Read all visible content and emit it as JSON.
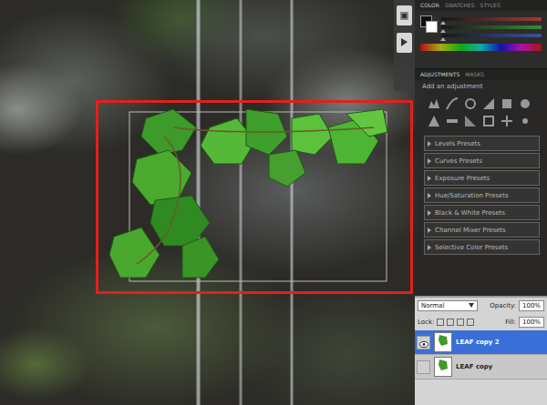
{
  "panels": {
    "color": {
      "tabs": [
        {
          "label": "COLOR",
          "selected": true
        },
        {
          "label": "SWATCHES",
          "selected": false
        },
        {
          "label": "STYLES",
          "selected": false
        }
      ],
      "sliders": [
        {
          "level": 0.02,
          "color": "#d04040"
        },
        {
          "level": 0.02,
          "color": "#40b040"
        },
        {
          "level": 0.02,
          "color": "#4060d0"
        }
      ]
    },
    "adjustments": {
      "tabs": [
        {
          "label": "ADJUSTMENTS",
          "selected": true
        },
        {
          "label": "MASKS",
          "selected": false
        }
      ],
      "hint": "Add an adjustment",
      "presets": [
        "Levels Presets",
        "Curves Presets",
        "Exposure Presets",
        "Hue/Saturation Presets",
        "Black & White Presets",
        "Channel Mixer Presets",
        "Selective Color Presets"
      ]
    },
    "layers": {
      "blend_mode": "Normal",
      "opacity_label": "Opacity:",
      "opacity": "100%",
      "lock_label": "Lock:",
      "fill_label": "Fill:",
      "fill": "100%",
      "items": [
        {
          "name": "LEAF copy 2",
          "visible": true,
          "selected": true
        },
        {
          "name": "LEAF copy",
          "visible": false,
          "selected": false
        }
      ]
    }
  }
}
